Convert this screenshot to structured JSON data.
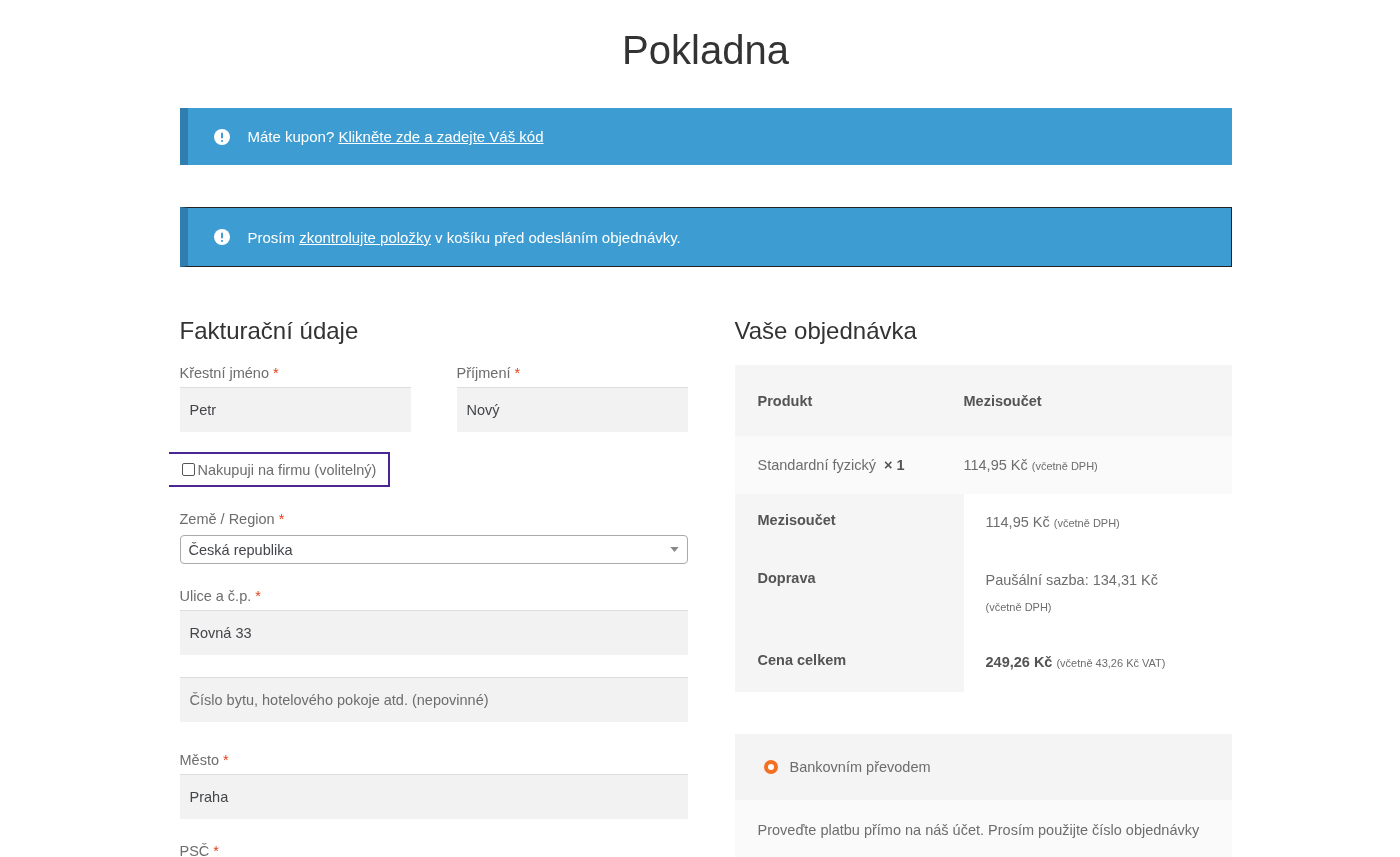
{
  "page": {
    "title": "Pokladna"
  },
  "notices": [
    {
      "text": "Máte kupon? ",
      "link": "Klikněte zde a zadejte Váš kód",
      "outlined": false
    },
    {
      "text": "Prosím ",
      "link": "zkontrolujte položky",
      "after": " v košíku před odesláním objednávky.",
      "outlined": true
    }
  ],
  "billing": {
    "heading": "Fakturační údaje",
    "name_fields": [
      {
        "label": "Křestní jméno",
        "required_mark": "*",
        "value": "Petr"
      },
      {
        "label": "Příjmení",
        "required_mark": "*",
        "value": "Nový"
      }
    ],
    "company_checkbox": {
      "label": "Nakupuji na firmu (volitelný)",
      "checked": false,
      "highlighted": true
    },
    "country": {
      "label": "Země / Region",
      "required_mark": "*",
      "value": "Česká republika"
    },
    "fields": [
      {
        "label": "Ulice a č.p.",
        "required_mark": "*",
        "value": "Rovná 33"
      },
      {
        "placeholder": "Číslo bytu, hotelového pokoje atd. (nepovinné)"
      },
      {
        "label": "Město",
        "required_mark": "*",
        "value": "Praha"
      },
      {
        "label": "PSČ",
        "required_mark": "*"
      }
    ]
  },
  "order": {
    "heading": "Vaše objednávka",
    "columns": [
      "Produkt",
      "Mezisoučet"
    ],
    "items": [
      {
        "name": "Standardní fyzický",
        "qty": "× 1",
        "price": "114,95 Kč",
        "note": "(včetně DPH)"
      }
    ],
    "totals": [
      {
        "label": "Mezisoučet",
        "value": "114,95 Kč",
        "note": "(včetně DPH)",
        "strong": false
      },
      {
        "label": "Doprava",
        "value": "Paušální sazba: 134,31 Kč",
        "note": "(včetně DPH)",
        "strong": false
      },
      {
        "label": "Cena celkem",
        "value": "249,26 Kč",
        "note": "(včetně 43,26 Kč VAT)",
        "strong": true
      }
    ]
  },
  "payment": {
    "methods": [
      {
        "label": "Bankovním převodem",
        "selected": true
      }
    ],
    "description": "Proveďte platbu přímo na náš účet. Prosím použijte číslo objednávky"
  }
}
